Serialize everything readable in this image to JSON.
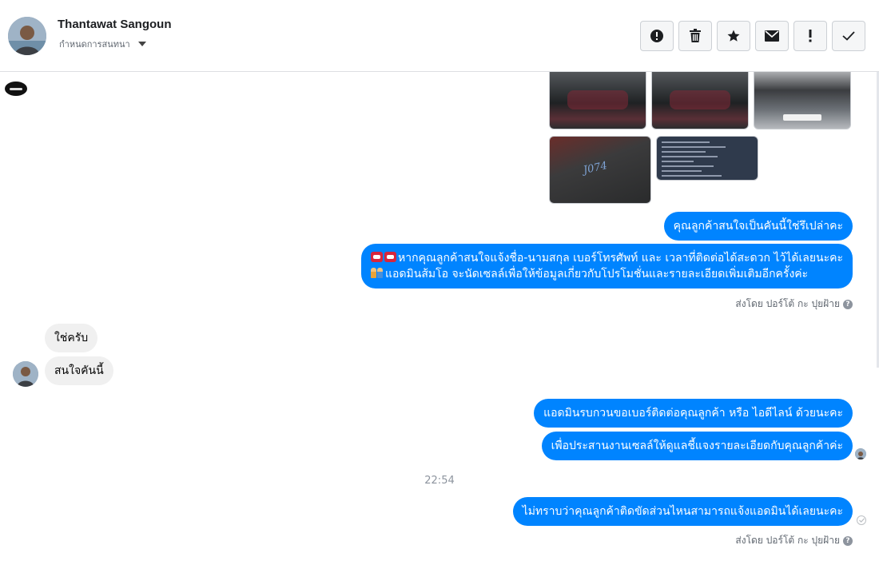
{
  "header": {
    "contact_name": "Thantawat Sangoun",
    "assign_label": "กำหนดการสนทนา"
  },
  "toolbar": {
    "buttons": [
      {
        "name": "report-button",
        "icon": "alert-circle-icon"
      },
      {
        "name": "delete-button",
        "icon": "trash-icon"
      },
      {
        "name": "star-button",
        "icon": "star-icon"
      },
      {
        "name": "mark-unread-button",
        "icon": "envelope-icon"
      },
      {
        "name": "important-button",
        "icon": "exclamation-icon"
      },
      {
        "name": "done-button",
        "icon": "check-icon"
      }
    ]
  },
  "messages": {
    "out_1": "คุณลูกค้าสนใจเป็นคันนี้ใช่รึเปล่าคะ",
    "out_2_line1": "หากคุณลูกค้าสนใจแจ้งชื่อ-นามสกุล เบอร์โทรศัพท์ และ เวลาที่ติดต่อได้สะดวก ไว้ได้เลยนะคะ",
    "out_2_line2": "แอดมินส้มโอ จะนัดเซลล์เพื่อให้ข้อมูลเกี่ยวกับโปรโมชั่นและรายละเอียดเพิ่มเติมอีกครั้งค่ะ",
    "sent_by_1": "ส่งโดย ปอร์โต้ กะ ปุยฝ้าย",
    "in_1": "ใช่ครับ",
    "in_2": "สนใจคันนี้",
    "out_3": "แอดมินรบกวนขอเบอร์ติดต่อคุณลูกค้า หรือ ไอดีไลน์ ด้วยนะคะ",
    "out_4": "เพื่อประสานงานเซลล์ให้ดูแลชี้แจงรายละเอียดกับคุณลูกค้าค่ะ",
    "timestamp": "22:54",
    "out_5": "ไม่ทราบว่าคุณลูกค้าติดขัดส่วนไหนสามารถแจ้งแอดมินได้เลยนะคะ",
    "sent_by_2": "ส่งโดย ปอร์โต้ กะ ปุยฝ้าย",
    "help_glyph": "?"
  },
  "colors": {
    "outgoing_bubble": "#0084ff",
    "incoming_bubble": "#f0f0f0"
  }
}
